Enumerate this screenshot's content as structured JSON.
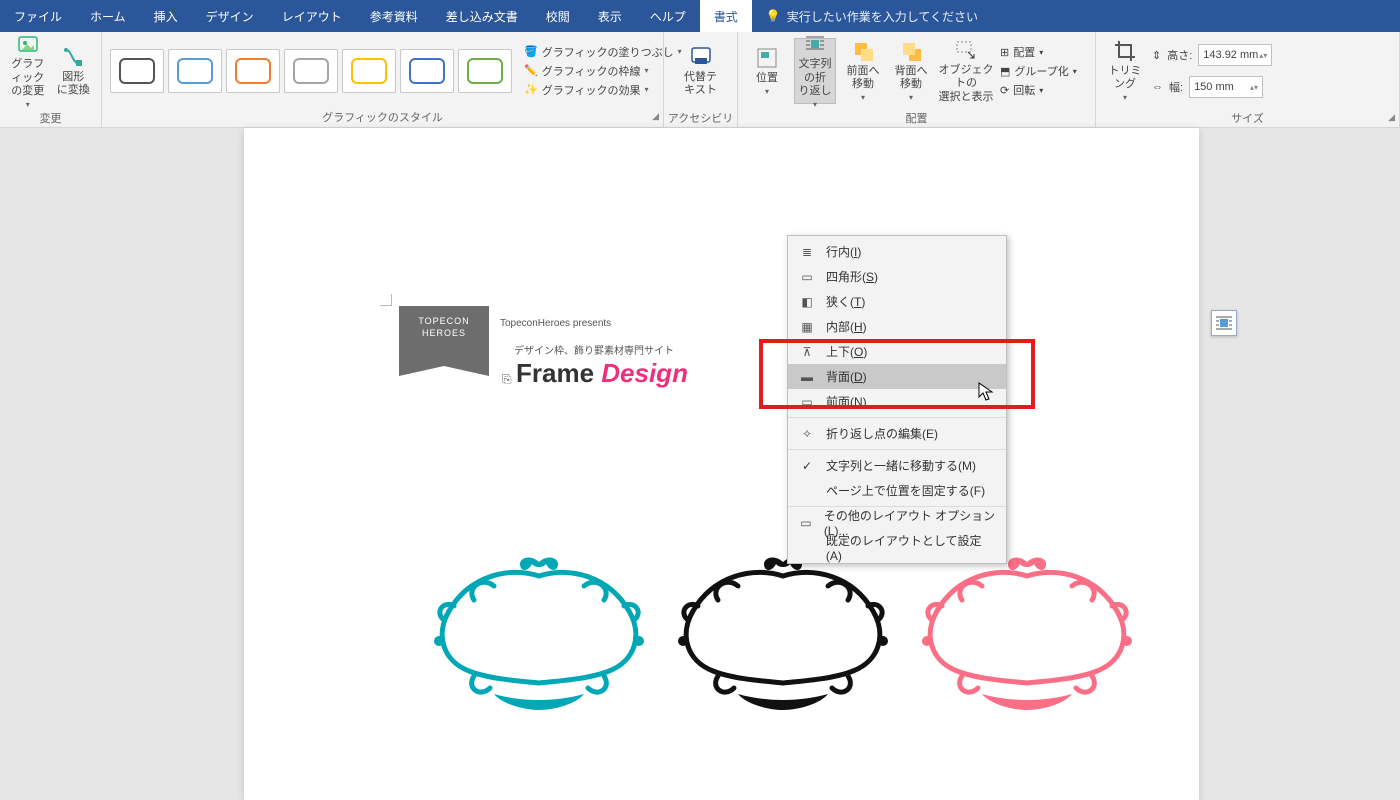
{
  "tabs": [
    "ファイル",
    "ホーム",
    "挿入",
    "デザイン",
    "レイアウト",
    "参考資料",
    "差し込み文書",
    "校閲",
    "表示",
    "ヘルプ",
    "書式"
  ],
  "active_tab_index": 10,
  "search_placeholder": "実行したい作業を入力してください",
  "ribbon": {
    "change": {
      "label": "変更",
      "edit_graphic": "グラフィック\nの変更",
      "convert_shape": "図形\nに変換"
    },
    "styles": {
      "label": "グラフィックのスタイル",
      "thumbs": [
        "#555555",
        "#5b9bd5",
        "#ed7d31",
        "#a5a5a5",
        "#ffc000",
        "#4472c4",
        "#70ad47"
      ],
      "fill": "グラフィックの塗りつぶし",
      "outline": "グラフィックの枠線",
      "effects": "グラフィックの効果"
    },
    "access": {
      "label": "アクセシビリティ",
      "alt": "代替テ\nキスト"
    },
    "arrange": {
      "label": "配置",
      "position": "位置",
      "wrap": "文字列の折\nり返し",
      "bring": "前面へ\n移動",
      "send": "背面へ\n移動",
      "select": "オブジェクトの\n選択と表示",
      "align": "配置",
      "group": "グループ化",
      "rotate": "回転"
    },
    "size": {
      "label": "サイズ",
      "trim": "トリミング",
      "height_label": "高さ:",
      "height_value": "143.92 mm",
      "width_label": "幅:",
      "width_value": "150 mm"
    }
  },
  "menu": {
    "items": [
      {
        "label": "行内(I)",
        "u": "I"
      },
      {
        "label": "四角形(S)",
        "u": "S"
      },
      {
        "label": "狭く(T)",
        "u": "T"
      },
      {
        "label": "内部(H)",
        "u": "H"
      },
      {
        "label": "上下(O)",
        "u": "O"
      },
      {
        "label": "背面(D)",
        "u": "D",
        "hover": true
      },
      {
        "label": "前面(N)",
        "u": "N"
      }
    ],
    "edit_points": "折り返し点の編集(E)",
    "move_with_text": "文字列と一緒に移動する(M)",
    "fix_on_page": "ページ上で位置を固定する(F)",
    "more_layout": "その他のレイアウト オプション(L)...",
    "set_default": "既定のレイアウトとして設定(A)"
  },
  "doc": {
    "brand_top": "TOPECON",
    "brand_bottom": "HEROES",
    "presents": "TopeconHeroes presents",
    "tagline": "デザイン枠、飾り罫素材専門サイト",
    "logo_a": "Frame ",
    "logo_b": "Design",
    "frame_colors": [
      "#00a7b5",
      "#111111",
      "#fa6e86"
    ]
  }
}
